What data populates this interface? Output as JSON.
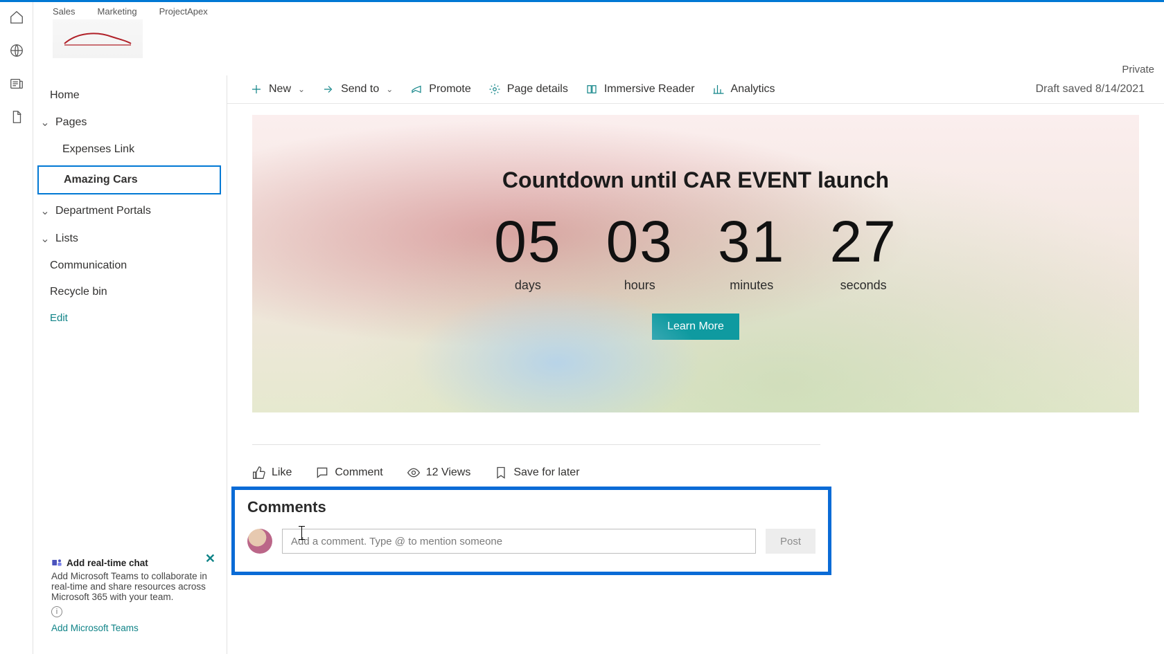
{
  "topTabs": {
    "t0": "Sales",
    "t1": "Marketing",
    "t2": "ProjectApex"
  },
  "privacy": "Private",
  "leftNav": {
    "home": "Home",
    "pages": "Pages",
    "sub_expenses": "Expenses Link",
    "sub_amazing": "Amazing Cars",
    "dept": "Department Portals",
    "lists": "Lists",
    "comm": "Communication",
    "recycle": "Recycle bin",
    "edit": "Edit"
  },
  "cmd": {
    "new": "New",
    "send": "Send to",
    "promote": "Promote",
    "details": "Page details",
    "reader": "Immersive Reader",
    "analytics": "Analytics",
    "draft": "Draft saved 8/14/2021"
  },
  "hero": {
    "title": "Countdown until CAR EVENT launch",
    "d": "05",
    "h": "03",
    "m": "31",
    "s": "27",
    "dl": "days",
    "hl": "hours",
    "ml": "minutes",
    "sl": "seconds",
    "learn": "Learn More"
  },
  "social": {
    "like": "Like",
    "comment": "Comment",
    "views": "12 Views",
    "save": "Save for later"
  },
  "comments": {
    "title": "Comments",
    "placeholder": "Add a comment. Type @ to mention someone",
    "post": "Post"
  },
  "promo": {
    "title": "Add real-time chat",
    "body": "Add Microsoft Teams to collaborate in real-time and share resources across Microsoft 365 with your team.",
    "link": "Add Microsoft Teams"
  }
}
